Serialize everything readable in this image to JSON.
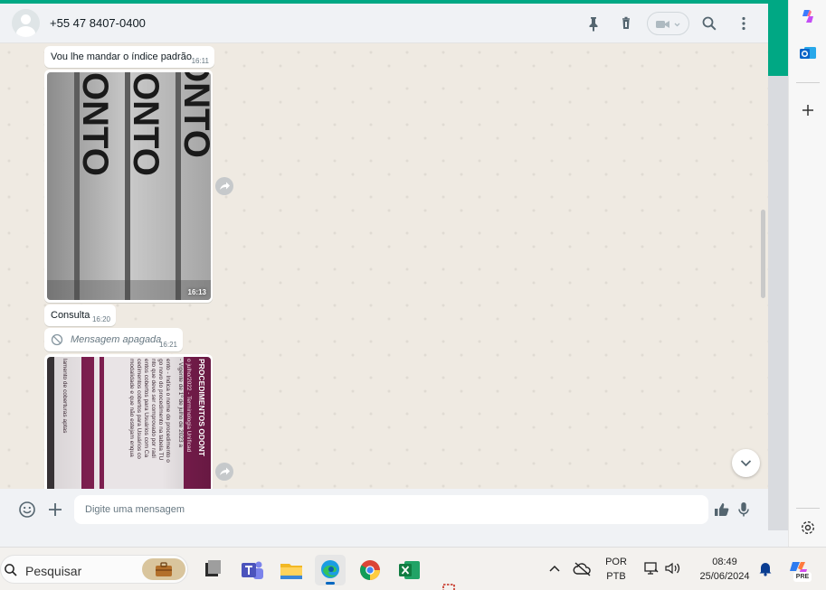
{
  "colors": {
    "accent": "#00a884",
    "chat_bg": "#efeae2",
    "bubble": "#ffffff",
    "panel": "#f0f2f5"
  },
  "header": {
    "contact_name": "+55 47 8407-0400",
    "icons": [
      "pin-icon",
      "trash-icon",
      "video-call-icon",
      "search-icon",
      "more-icon"
    ]
  },
  "messages": [
    {
      "type": "text",
      "text": "Vou lhe mandar o índice padrão",
      "time": "16:11"
    },
    {
      "type": "image",
      "time": "16:13",
      "image_text": "ONTO"
    },
    {
      "type": "text",
      "text": "Consulta",
      "time": "16:20"
    },
    {
      "type": "deleted",
      "text": "Mensagem apagada",
      "time": "16:21"
    },
    {
      "type": "image",
      "image_lines": [
        "PROCEDIMENTOS ODONT",
        "o julho/2022 - Terminologia Unificad",
        "- Vigente de 1º de julho de 2023 a",
        "ento - Indica o nome do procedimento o",
        "go novo do procedimento na tabela TU",
        "nto que deve ser comprovado por radi",
        "entos cobertos para Usuários com Ca",
        "cedimentos cobertos para Usuários co",
        "modalidade e que não estejam enqua",
        "lamento de coberturas aptas"
      ]
    }
  ],
  "composer": {
    "placeholder": "Digite uma mensagem"
  },
  "taskbar": {
    "search_label": "Pesquisar",
    "apps": [
      "briefcase-icon",
      "task-view-icon",
      "teams-icon",
      "file-explorer-icon",
      "edge-icon",
      "chrome-icon",
      "excel-icon"
    ],
    "language": "POR",
    "keyboard": "PTB",
    "time": "08:49",
    "date": "25/06/2024",
    "copilot_badge": "PRE"
  }
}
